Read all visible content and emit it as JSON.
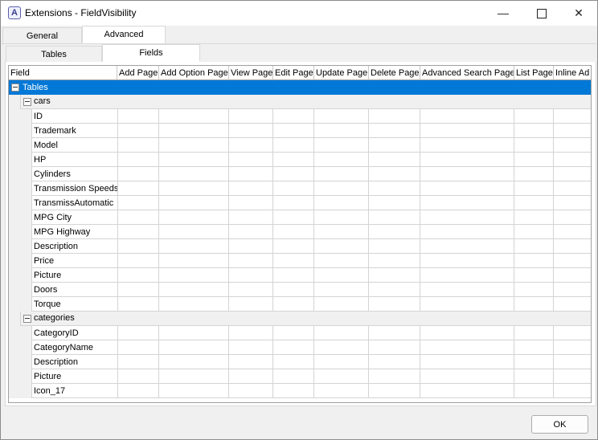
{
  "window": {
    "title": "Extensions - FieldVisibility",
    "app_icon": "A"
  },
  "tabs_top": [
    {
      "label": "General",
      "active": false
    },
    {
      "label": "Advanced",
      "active": true
    }
  ],
  "tabs_sub": [
    {
      "label": "Tables",
      "active": false
    },
    {
      "label": "Fields",
      "active": true
    }
  ],
  "grid": {
    "columns": [
      "Field",
      "Add Page",
      "Add Option Page",
      "View Page",
      "Edit Page",
      "Update Page",
      "Delete Page",
      "Advanced Search Page",
      "List Page",
      "Inline Ad"
    ],
    "root_label": "Tables",
    "groups": [
      {
        "name": "cars",
        "fields": [
          "ID",
          "Trademark",
          "Model",
          "HP",
          "Cylinders",
          "Transmission Speeds",
          "TransmissAutomatic",
          "MPG City",
          "MPG Highway",
          "Description",
          "Price",
          "Picture",
          "Doors",
          "Torque"
        ]
      },
      {
        "name": "categories",
        "fields": [
          "CategoryID",
          "CategoryName",
          "Description",
          "Picture",
          "Icon_17"
        ]
      }
    ]
  },
  "buttons": {
    "ok": "OK"
  },
  "colors": {
    "selection": "#0078d7",
    "group_bg": "#f0f0f0"
  }
}
